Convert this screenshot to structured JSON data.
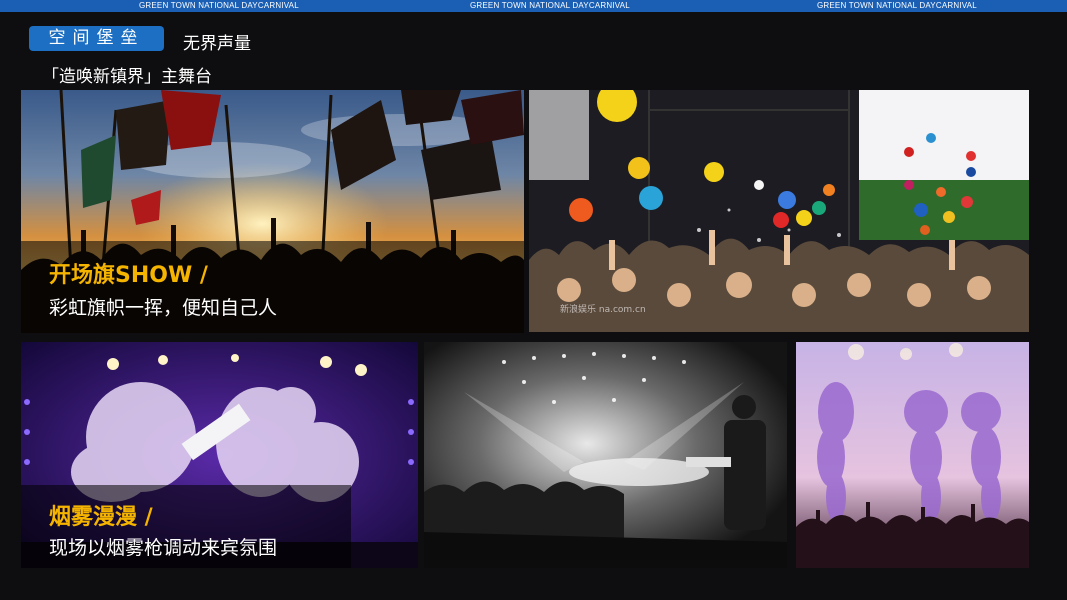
{
  "banner": {
    "text_1": "GREEN TOWN   NATIONAL DAYCARNIVAL",
    "text_2": "GREEN TOWN   NATIONAL DAYCARNIVAL",
    "text_3": "GREEN TOWN   NATIONAL DAYCARNIVAL",
    "color": "#1a5fb4"
  },
  "header": {
    "section_pill": "空间堡垒",
    "section_subtitle": "无界声量",
    "stage_title": "「造唤新镇界」主舞台"
  },
  "cards": [
    {
      "heading": "开场旗SHOW /",
      "body": "彩虹旗帜一挥，便知自己人"
    },
    {
      "heading": "烟雾漫漫 /",
      "body": "现场以烟雾枪调动来宾氛围"
    }
  ],
  "watermark": "新浪娱乐 na.com.cn",
  "colors": {
    "accent": "#f5b400",
    "pill": "#1c6fc2",
    "background": "#0e0e10"
  }
}
